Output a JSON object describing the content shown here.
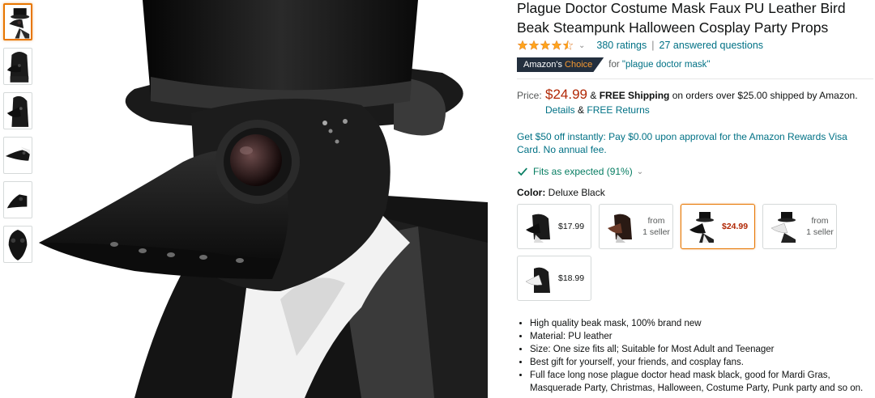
{
  "thumbnails": [
    {
      "name": "thumb-front-top-hat",
      "selected": true
    },
    {
      "name": "thumb-hooded"
    },
    {
      "name": "thumb-side-hood"
    },
    {
      "name": "thumb-mask-only-side"
    },
    {
      "name": "thumb-mask-only-angled"
    },
    {
      "name": "thumb-mask-front"
    }
  ],
  "product": {
    "title": "Plague Doctor Costume Mask Faux PU Leather Bird Beak Steampunk Halloween Cosplay Party Props",
    "ratings_text": "380 ratings",
    "questions_text": "27 answered questions",
    "separator": "|",
    "rating_value": 4.5
  },
  "badge": {
    "amazons": "Amazon's",
    "choice": "Choice",
    "for_text": "for \"plague doctor mask\""
  },
  "price": {
    "label": "Price:",
    "value": "$24.99",
    "amp": "&",
    "free_shipping": "FREE Shipping",
    "shipping_rest": "on orders over $25.00 shipped by Amazon.",
    "details": "Details",
    "amp2": "&",
    "free_returns": "FREE Returns"
  },
  "promo": "Get $50 off instantly: Pay $0.00 upon approval for the Amazon Rewards Visa Card. No annual fee.",
  "fit": "Fits as expected (91%)",
  "color": {
    "label": "Color:",
    "value": "Deluxe Black"
  },
  "swatches": [
    {
      "price": "$17.99"
    },
    {
      "from1": "from",
      "from2": "1 seller"
    },
    {
      "price": "$24.99",
      "selected": true
    },
    {
      "from1": "from",
      "from2": "1 seller"
    },
    {
      "price": "$18.99"
    }
  ],
  "bullets": [
    "High quality beak mask, 100% brand new",
    "Material: PU leather",
    "Size: One size fits all; Suitable for Most Adult and Teenager",
    "Best gift for yourself, your friends, and cosplay fans.",
    "Full face long nose plague doctor head mask black, good for Mardi Gras, Masquerade Party, Christmas, Halloween, Costume Party, Punk party and so on."
  ],
  "colors": {
    "link": "#007185",
    "price": "#b12704",
    "badge_bg": "#232f3e",
    "badge_accent": "#f69931",
    "fit_green": "#067d62",
    "star": "#ffa41c"
  }
}
